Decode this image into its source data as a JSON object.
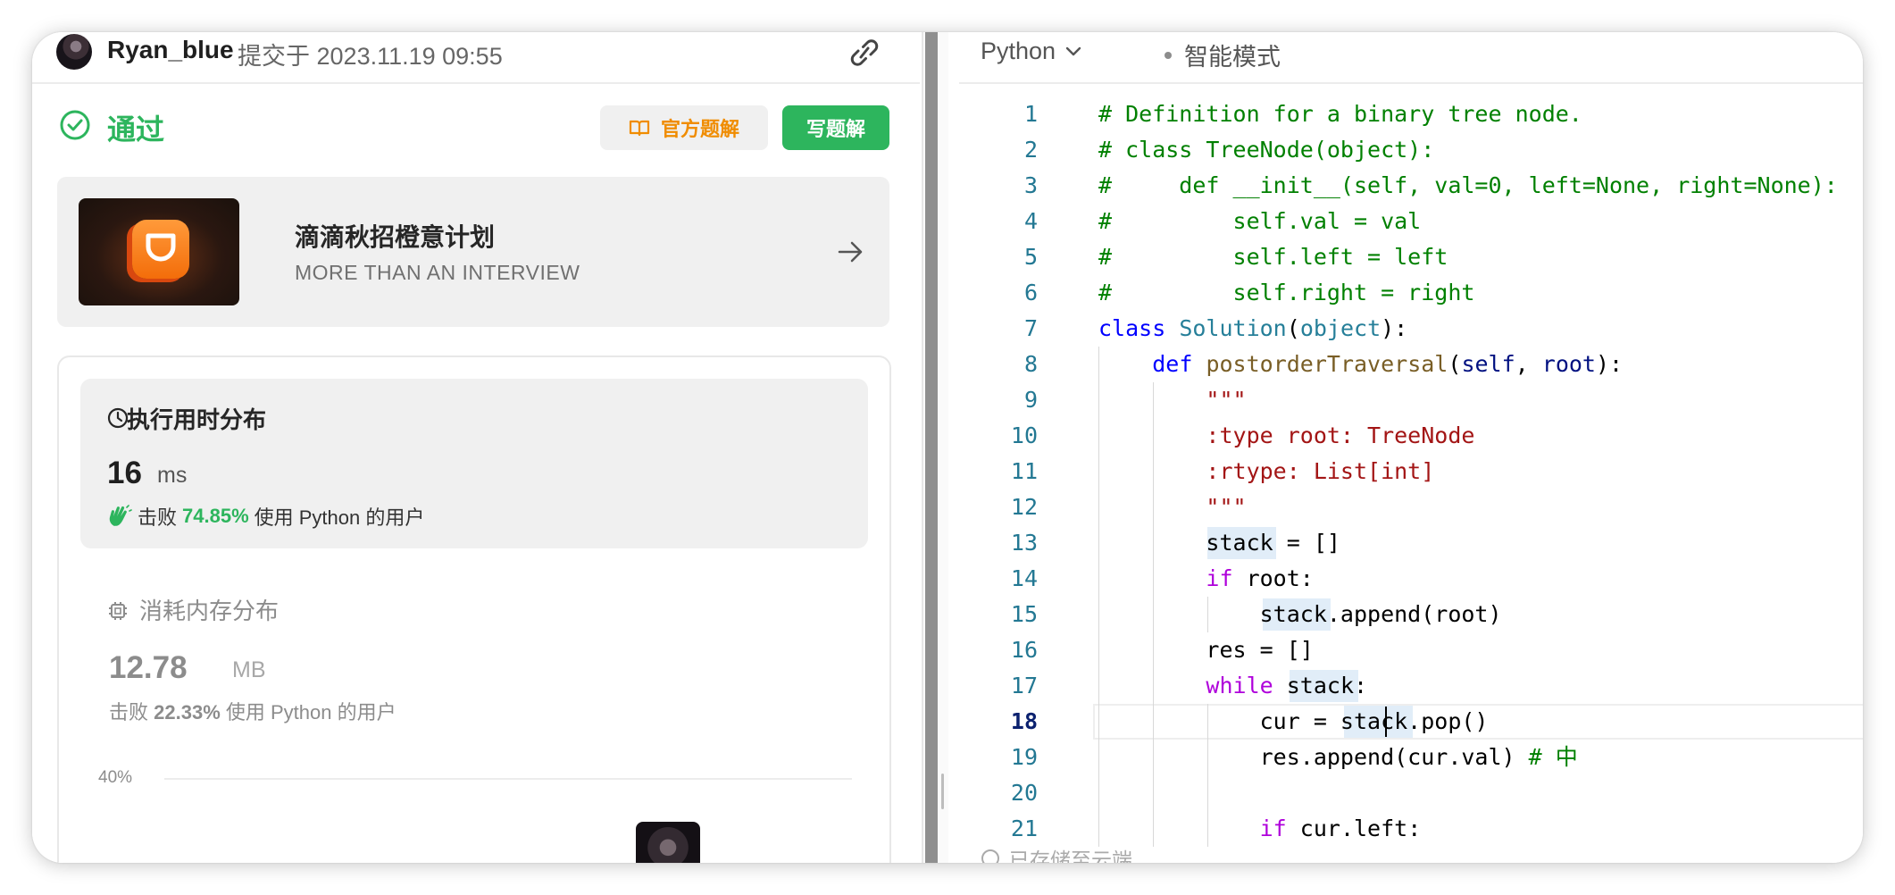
{
  "submission": {
    "username": "Ryan_blue",
    "submitted_prefix": "提交于",
    "timestamp": "2023.11.19 09:55"
  },
  "result": {
    "status": "通过",
    "official_solution_label": "官方题解",
    "write_solution_label": "写题解"
  },
  "ad": {
    "title": "滴滴秋招橙意计划",
    "subtitle": "MORE THAN AN INTERVIEW"
  },
  "runtime": {
    "title": "执行用时分布",
    "value": "16",
    "unit": "ms",
    "beat_prefix": "击败",
    "beat_percent": "74.85%",
    "beat_suffix": "使用 Python 的用户"
  },
  "memory": {
    "title": "消耗内存分布",
    "value": "12.78",
    "unit": "MB",
    "beat_prefix": "击败",
    "beat_percent": "22.33%",
    "beat_suffix": "使用 Python 的用户"
  },
  "chart": {
    "y_tick": "40%"
  },
  "editor": {
    "language": "Python",
    "mode": "智能模式",
    "save_status": "已存储至云端",
    "active_line": 18,
    "lines": [
      "# Definition for a binary tree node.",
      "# class TreeNode(object):",
      "#     def __init__(self, val=0, left=None, right=None):",
      "#         self.val = val",
      "#         self.left = left",
      "#         self.right = right",
      "class Solution(object):",
      "    def postorderTraversal(self, root):",
      "        \"\"\"",
      "        :type root: TreeNode",
      "        :rtype: List[int]",
      "        \"\"\"",
      "        stack = []",
      "        if root:",
      "            stack.append(root)",
      "        res = []",
      "        while stack:",
      "            cur = stack.pop()",
      "            res.append(cur.val) # 中",
      "",
      "            if cur.left:"
    ]
  },
  "colors": {
    "success_green": "#2db55d",
    "accent_orange": "#f08c00",
    "comment_green": "#008000",
    "keyword_blue": "#0000ff",
    "control_purple": "#af00db",
    "string_red": "#a31515"
  },
  "icons": [
    "link-icon",
    "check-circle-icon",
    "book-icon",
    "arrow-right-icon",
    "clock-icon",
    "hand-icon",
    "chip-icon",
    "chevron-down-icon",
    "cloud-icon"
  ]
}
